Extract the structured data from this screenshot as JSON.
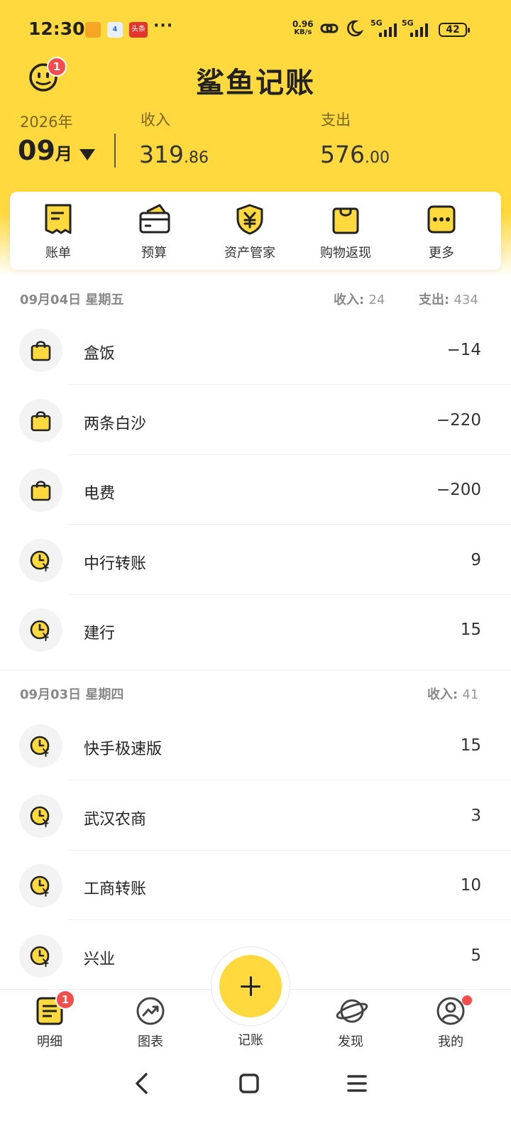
{
  "status_bar": {
    "time": "12:30",
    "apps": [
      "4",
      "头条"
    ],
    "more": "···",
    "net_speed_value": "0.96",
    "net_speed_unit": "KB/s",
    "signal1": "5G",
    "signal2": "5G",
    "battery": "42"
  },
  "header": {
    "title": "鲨鱼记账",
    "notification_count": "1",
    "year": "2026年",
    "month": "09",
    "month_suffix": "月",
    "income_label": "收入",
    "income_int": "319",
    "income_dec": ".86",
    "expense_label": "支出",
    "expense_int": "576",
    "expense_dec": ".00"
  },
  "quick_menu": [
    {
      "label": "账单",
      "icon": "bill-icon"
    },
    {
      "label": "预算",
      "icon": "budget-wallet-icon"
    },
    {
      "label": "资产管家",
      "icon": "asset-shield-icon"
    },
    {
      "label": "购物返现",
      "icon": "shopping-bag-icon"
    },
    {
      "label": "更多",
      "icon": "more-icon"
    }
  ],
  "days": [
    {
      "date": "09月04日 星期五",
      "income_label": "收入:",
      "income": "24",
      "expense_label": "支出:",
      "expense": "434",
      "items": [
        {
          "name": "盒饭",
          "amount": "−14",
          "icon": "shopping-bag-icon"
        },
        {
          "name": "两条白沙",
          "amount": "−220",
          "icon": "shopping-bag-icon"
        },
        {
          "name": "电费",
          "amount": "−200",
          "icon": "shopping-bag-icon"
        },
        {
          "name": "中行转账",
          "amount": "9",
          "icon": "clock-yuan-icon"
        },
        {
          "name": "建行",
          "amount": "15",
          "icon": "clock-yuan-icon"
        }
      ]
    },
    {
      "date": "09月03日 星期四",
      "income_label": "收入:",
      "income": "41",
      "items": [
        {
          "name": "快手极速版",
          "amount": "15",
          "icon": "clock-yuan-icon"
        },
        {
          "name": "武汉农商",
          "amount": "3",
          "icon": "clock-yuan-icon"
        },
        {
          "name": "工商转账",
          "amount": "10",
          "icon": "clock-yuan-icon"
        },
        {
          "name": "兴业",
          "amount": "5",
          "icon": "clock-yuan-icon"
        }
      ]
    }
  ],
  "tabbar": {
    "details": "明细",
    "details_badge": "1",
    "charts": "图表",
    "record": "记账",
    "discover": "发现",
    "mine": "我的"
  },
  "colors": {
    "brand_yellow": "#ffd93d",
    "badge_red": "#f44d4d"
  }
}
